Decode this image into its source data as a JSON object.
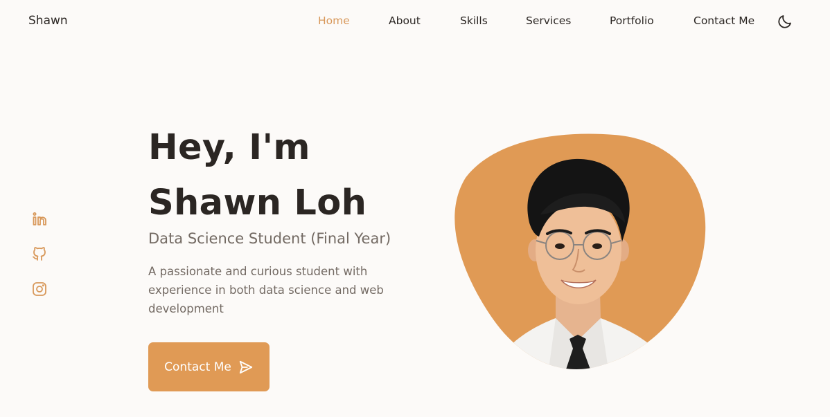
{
  "header": {
    "logo": "Shawn",
    "nav": [
      {
        "label": "Home",
        "active": true
      },
      {
        "label": "About",
        "active": false
      },
      {
        "label": "Skills",
        "active": false
      },
      {
        "label": "Services",
        "active": false
      },
      {
        "label": "Portfolio",
        "active": false
      },
      {
        "label": "Contact Me",
        "active": false
      }
    ],
    "theme_toggle_icon": "moon-icon"
  },
  "socials": [
    {
      "icon": "linkedin-icon"
    },
    {
      "icon": "github-icon"
    },
    {
      "icon": "instagram-icon"
    }
  ],
  "hero": {
    "title_line1": "Hey, I'm",
    "title_line2": "Shawn Loh",
    "subtitle": "Data Science Student (Final Year)",
    "description": "A passionate and curious student with experience in both data science and web development",
    "cta_label": "Contact Me",
    "cta_icon": "send-icon"
  },
  "colors": {
    "accent": "#e09a55",
    "background": "#fcfaf8",
    "text": "#2b2623",
    "muted": "#736a63"
  }
}
